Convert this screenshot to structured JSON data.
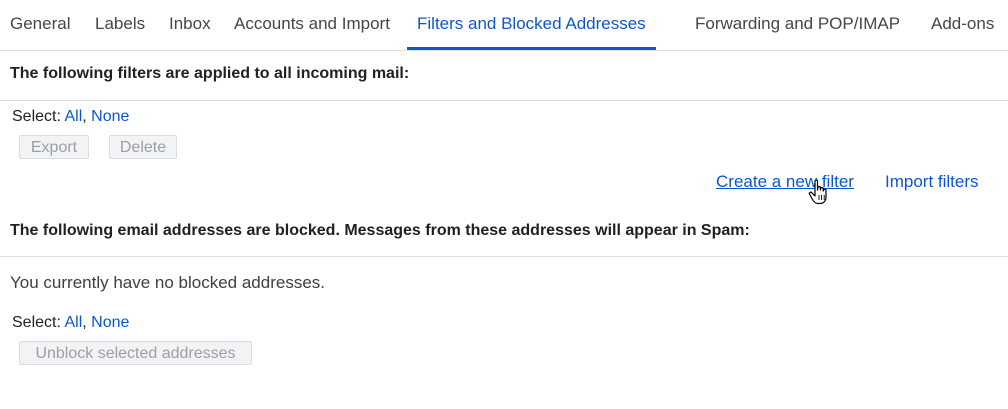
{
  "tabs": [
    {
      "label": "General"
    },
    {
      "label": "Labels"
    },
    {
      "label": "Inbox"
    },
    {
      "label": "Accounts and Import"
    },
    {
      "label": "Filters and Blocked Addresses"
    },
    {
      "label": "Forwarding and POP/IMAP"
    },
    {
      "label": "Add-ons"
    }
  ],
  "active_tab": "Filters and Blocked Addresses",
  "filters": {
    "heading": "The following filters are applied to all incoming mail:",
    "select_label": "Select:",
    "select_all": "All",
    "select_none": "None",
    "separator": ",",
    "export_button": "Export",
    "delete_button": "Delete",
    "create_filter_link": "Create a new filter",
    "import_filters_link": "Import filters"
  },
  "blocked": {
    "heading": "The following email addresses are blocked. Messages from these addresses will appear in Spam:",
    "empty_message": "You currently have no blocked addresses.",
    "select_label": "Select:",
    "select_all": "All",
    "select_none": "None",
    "separator": ",",
    "unblock_button": "Unblock selected addresses"
  },
  "colors": {
    "accent": "#0b57d0",
    "disabled_text": "#9aa0a6",
    "divider": "#e0e0e0"
  },
  "icons": {
    "cursor": "hand-pointer-icon"
  }
}
